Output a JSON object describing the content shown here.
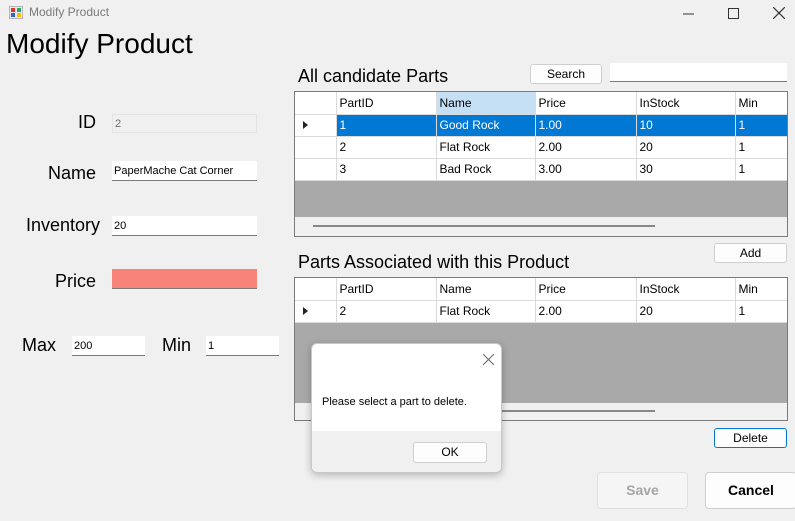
{
  "window": {
    "title": "Modify Product",
    "controls": {
      "minimize": "—",
      "maximize": "☐",
      "close": "✕"
    }
  },
  "heading": "Modify Product",
  "form": {
    "id_label": "ID",
    "id_value": "2",
    "name_label": "Name",
    "name_value": "PaperMache Cat Corner",
    "inventory_label": "Inventory",
    "inventory_value": "20",
    "price_label": "Price",
    "price_value": "",
    "max_label": "Max",
    "max_value": "200",
    "min_label": "Min",
    "min_value": "1"
  },
  "candidates": {
    "title": "All candidate Parts",
    "search_button": "Search",
    "search_value": "",
    "columns": [
      "PartID",
      "Name",
      "Price",
      "InStock",
      "Min"
    ],
    "rows": [
      [
        "1",
        "Good Rock",
        "1.00",
        "10",
        "1"
      ],
      [
        "2",
        "Flat Rock",
        "2.00",
        "20",
        "1"
      ],
      [
        "3",
        "Bad Rock",
        "3.00",
        "30",
        "1"
      ]
    ],
    "add_button": "Add"
  },
  "associated": {
    "title": "Parts Associated with this Product",
    "columns": [
      "PartID",
      "Name",
      "Price",
      "InStock",
      "Min"
    ],
    "rows": [
      [
        "2",
        "Flat Rock",
        "2.00",
        "20",
        "1"
      ]
    ],
    "delete_button": "Delete"
  },
  "footer": {
    "save_button": "Save",
    "cancel_button": "Cancel"
  },
  "dialog": {
    "message": "Please select a part to delete.",
    "ok_button": "OK",
    "close": "✕"
  },
  "colors": {
    "selection": "#0078d4",
    "error_field": "#f8837a",
    "header_sorted": "#c5dff5"
  }
}
